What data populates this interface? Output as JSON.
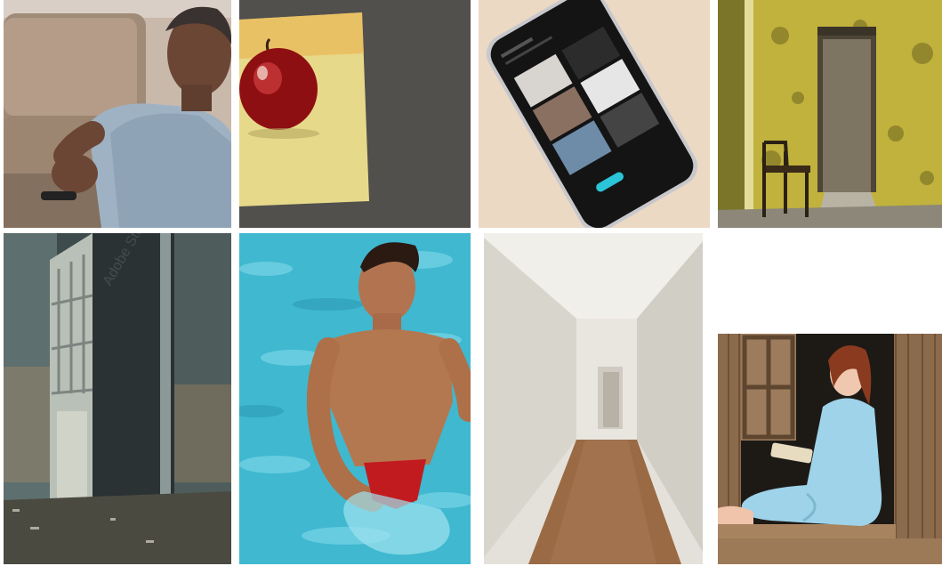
{
  "gallery": {
    "tiles": [
      {
        "subject": "angry-man-on-couch",
        "background": "#b9a89a"
      },
      {
        "subject": "red-apple-on-yellow-paper",
        "background": "#4a4a4a"
      },
      {
        "subject": "smartphone-on-wooden-table",
        "background": "#e6d1b8"
      },
      {
        "subject": "abandoned-room-yellow-walls-chair",
        "background": "#a9a23a"
      },
      {
        "subject": "abandoned-corridor-open-door",
        "background": "#3e4a4b"
      },
      {
        "subject": "smiling-man-in-pool",
        "background": "#4cc0d6"
      },
      {
        "subject": "empty-white-hallway",
        "background": "#dedbd3"
      },
      {
        "subject": "woman-reading-in-wooden-window",
        "background": "#8a6a4d"
      }
    ],
    "watermark_text": "Adobe Stock"
  }
}
